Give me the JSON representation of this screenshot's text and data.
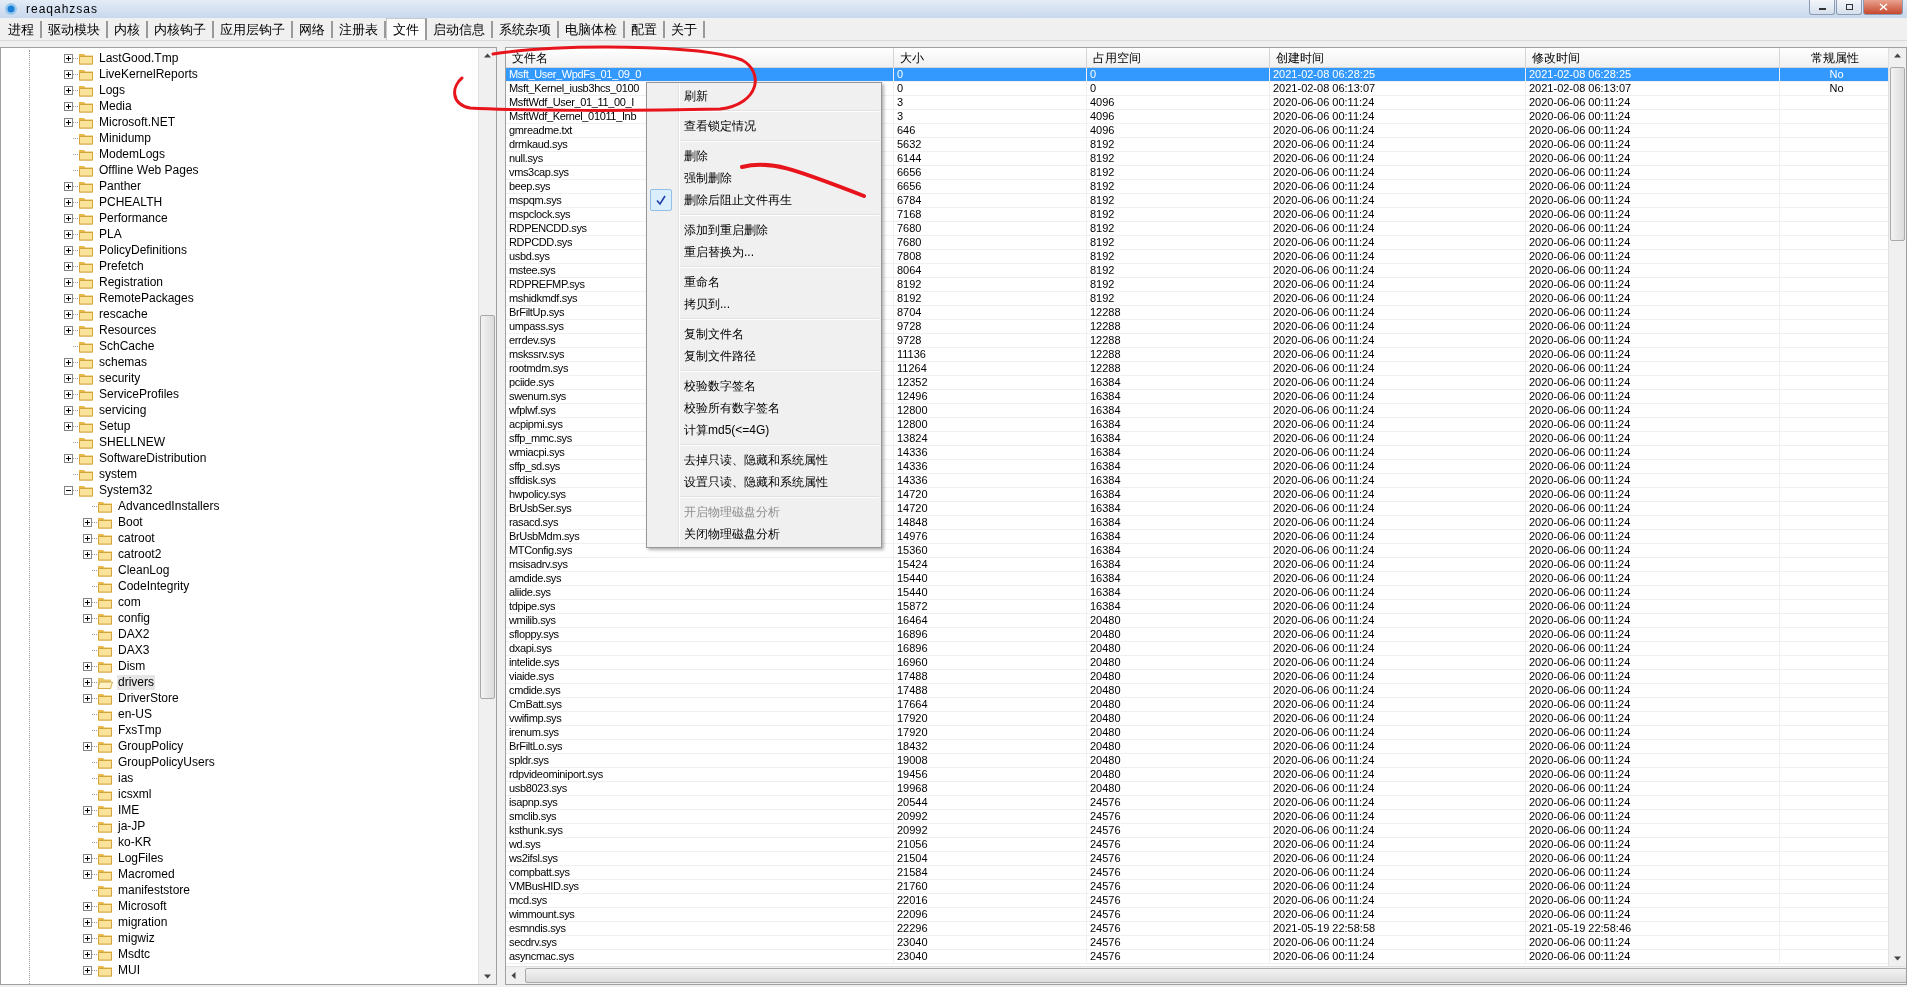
{
  "window": {
    "title": "reaqahzsas"
  },
  "tabs": [
    {
      "label": "进程",
      "selected": false
    },
    {
      "label": "驱动模块",
      "selected": false
    },
    {
      "label": "内核",
      "selected": false
    },
    {
      "label": "内核钩子",
      "selected": false
    },
    {
      "label": "应用层钩子",
      "selected": false
    },
    {
      "label": "网络",
      "selected": false
    },
    {
      "label": "注册表",
      "selected": false
    },
    {
      "label": "文件",
      "selected": true
    },
    {
      "label": "启动信息",
      "selected": false
    },
    {
      "label": "系统杂项",
      "selected": false
    },
    {
      "label": "电脑体检",
      "selected": false
    },
    {
      "label": "配置",
      "selected": false
    },
    {
      "label": "关于",
      "selected": false
    }
  ],
  "tree": [
    {
      "label": "LastGood.Tmp",
      "expandable": true,
      "expanded": false,
      "selected": false
    },
    {
      "label": "LiveKernelReports",
      "expandable": true,
      "expanded": false,
      "selected": false
    },
    {
      "label": "Logs",
      "expandable": true,
      "expanded": false,
      "selected": false
    },
    {
      "label": "Media",
      "expandable": true,
      "expanded": false,
      "selected": false
    },
    {
      "label": "Microsoft.NET",
      "expandable": true,
      "expanded": false,
      "selected": false
    },
    {
      "label": "Minidump",
      "expandable": false,
      "selected": false
    },
    {
      "label": "ModemLogs",
      "expandable": false,
      "selected": false
    },
    {
      "label": "Offline Web Pages",
      "expandable": false,
      "selected": false
    },
    {
      "label": "Panther",
      "expandable": true,
      "expanded": false,
      "selected": false
    },
    {
      "label": "PCHEALTH",
      "expandable": true,
      "expanded": false,
      "selected": false
    },
    {
      "label": "Performance",
      "expandable": true,
      "expanded": false,
      "selected": false
    },
    {
      "label": "PLA",
      "expandable": true,
      "expanded": false,
      "selected": false
    },
    {
      "label": "PolicyDefinitions",
      "expandable": true,
      "expanded": false,
      "selected": false
    },
    {
      "label": "Prefetch",
      "expandable": true,
      "expanded": false,
      "selected": false
    },
    {
      "label": "Registration",
      "expandable": true,
      "expanded": false,
      "selected": false
    },
    {
      "label": "RemotePackages",
      "expandable": true,
      "expanded": false,
      "selected": false
    },
    {
      "label": "rescache",
      "expandable": true,
      "expanded": false,
      "selected": false
    },
    {
      "label": "Resources",
      "expandable": true,
      "expanded": false,
      "selected": false
    },
    {
      "label": "SchCache",
      "expandable": false,
      "selected": false
    },
    {
      "label": "schemas",
      "expandable": true,
      "expanded": false,
      "selected": false
    },
    {
      "label": "security",
      "expandable": true,
      "expanded": false,
      "selected": false
    },
    {
      "label": "ServiceProfiles",
      "expandable": true,
      "expanded": false,
      "selected": false
    },
    {
      "label": "servicing",
      "expandable": true,
      "expanded": false,
      "selected": false
    },
    {
      "label": "Setup",
      "expandable": true,
      "expanded": false,
      "selected": false
    },
    {
      "label": "SHELLNEW",
      "expandable": false,
      "selected": false
    },
    {
      "label": "SoftwareDistribution",
      "expandable": true,
      "expanded": false,
      "selected": false
    },
    {
      "label": "system",
      "expandable": false,
      "selected": false
    },
    {
      "label": "System32",
      "expandable": true,
      "expanded": true,
      "selected": false,
      "children": [
        {
          "label": "AdvancedInstallers",
          "expandable": false,
          "selected": false
        },
        {
          "label": "Boot",
          "expandable": true,
          "expanded": false,
          "selected": false
        },
        {
          "label": "catroot",
          "expandable": true,
          "expanded": false,
          "selected": false
        },
        {
          "label": "catroot2",
          "expandable": true,
          "expanded": false,
          "selected": false
        },
        {
          "label": "CleanLog",
          "expandable": false,
          "selected": false
        },
        {
          "label": "CodeIntegrity",
          "expandable": false,
          "selected": false
        },
        {
          "label": "com",
          "expandable": true,
          "expanded": false,
          "selected": false
        },
        {
          "label": "config",
          "expandable": true,
          "expanded": false,
          "selected": false
        },
        {
          "label": "DAX2",
          "expandable": false,
          "selected": false
        },
        {
          "label": "DAX3",
          "expandable": false,
          "selected": false
        },
        {
          "label": "Dism",
          "expandable": true,
          "expanded": false,
          "selected": false
        },
        {
          "label": "drivers",
          "expandable": true,
          "expanded": false,
          "selected": true
        },
        {
          "label": "DriverStore",
          "expandable": true,
          "expanded": false,
          "selected": false
        },
        {
          "label": "en-US",
          "expandable": false,
          "selected": false
        },
        {
          "label": "FxsTmp",
          "expandable": false,
          "selected": false
        },
        {
          "label": "GroupPolicy",
          "expandable": true,
          "expanded": false,
          "selected": false
        },
        {
          "label": "GroupPolicyUsers",
          "expandable": false,
          "selected": false
        },
        {
          "label": "ias",
          "expandable": false,
          "selected": false
        },
        {
          "label": "icsxml",
          "expandable": false,
          "selected": false
        },
        {
          "label": "IME",
          "expandable": true,
          "expanded": false,
          "selected": false
        },
        {
          "label": "ja-JP",
          "expandable": false,
          "selected": false
        },
        {
          "label": "ko-KR",
          "expandable": false,
          "selected": false
        },
        {
          "label": "LogFiles",
          "expandable": true,
          "expanded": false,
          "selected": false
        },
        {
          "label": "Macromed",
          "expandable": true,
          "expanded": false,
          "selected": false
        },
        {
          "label": "manifeststore",
          "expandable": false,
          "selected": false
        },
        {
          "label": "Microsoft",
          "expandable": true,
          "expanded": false,
          "selected": false
        },
        {
          "label": "migration",
          "expandable": true,
          "expanded": false,
          "selected": false
        },
        {
          "label": "migwiz",
          "expandable": true,
          "expanded": false,
          "selected": false
        },
        {
          "label": "Msdtc",
          "expandable": true,
          "expanded": false,
          "selected": false
        },
        {
          "label": "MUI",
          "expandable": true,
          "expanded": false,
          "selected": false
        }
      ]
    }
  ],
  "table": {
    "circle_mark": true,
    "columns": [
      "文件名",
      "大小",
      "占用空间",
      "创建时间",
      "修改时间",
      "常规属性"
    ],
    "rows": [
      {
        "cells": [
          "Msft_User_WpdFs_01_09_0",
          "0",
          "0",
          "2021-02-08 06:28:25",
          "2021-02-08 06:28:25",
          "No"
        ],
        "selected": true
      },
      {
        "cells": [
          "Msft_Kernel_iusb3hcs_0100",
          "0",
          "0",
          "2021-02-08 06:13:07",
          "2021-02-08 06:13:07",
          "No"
        ],
        "selected": false
      },
      {
        "cells": [
          "MsftWdf_User_01_11_00_I",
          "3",
          "4096",
          "2020-06-06 00:11:24",
          "2020-06-06 00:11:24"
        ],
        "selected": false
      },
      {
        "cells": [
          "MsftWdf_Kernel_01011_Inb",
          "3",
          "4096",
          "2020-06-06 00:11:24",
          "2020-06-06 00:11:24"
        ],
        "selected": false
      },
      {
        "cells": [
          "gmreadme.txt",
          "646",
          "4096",
          "2020-06-06 00:11:24",
          "2020-06-06 00:11:24"
        ],
        "selected": false
      },
      {
        "cells": [
          "drmkaud.sys",
          "5632",
          "8192",
          "2020-06-06 00:11:24",
          "2020-06-06 00:11:24"
        ],
        "selected": false
      },
      {
        "cells": [
          "null.sys",
          "6144",
          "8192",
          "2020-06-06 00:11:24",
          "2020-06-06 00:11:24"
        ],
        "selected": false
      },
      {
        "cells": [
          "vms3cap.sys",
          "6656",
          "8192",
          "2020-06-06 00:11:24",
          "2020-06-06 00:11:24"
        ],
        "selected": false
      },
      {
        "cells": [
          "beep.sys",
          "6656",
          "8192",
          "2020-06-06 00:11:24",
          "2020-06-06 00:11:24"
        ],
        "selected": false
      },
      {
        "cells": [
          "mspqm.sys",
          "6784",
          "8192",
          "2020-06-06 00:11:24",
          "2020-06-06 00:11:24"
        ],
        "selected": false
      },
      {
        "cells": [
          "mspclock.sys",
          "7168",
          "8192",
          "2020-06-06 00:11:24",
          "2020-06-06 00:11:24"
        ],
        "selected": false
      },
      {
        "cells": [
          "RDPENCDD.sys",
          "7680",
          "8192",
          "2020-06-06 00:11:24",
          "2020-06-06 00:11:24"
        ],
        "selected": false
      },
      {
        "cells": [
          "RDPCDD.sys",
          "7680",
          "8192",
          "2020-06-06 00:11:24",
          "2020-06-06 00:11:24"
        ],
        "selected": false
      },
      {
        "cells": [
          "usbd.sys",
          "7808",
          "8192",
          "2020-06-06 00:11:24",
          "2020-06-06 00:11:24"
        ],
        "selected": false
      },
      {
        "cells": [
          "mstee.sys",
          "8064",
          "8192",
          "2020-06-06 00:11:24",
          "2020-06-06 00:11:24"
        ],
        "selected": false
      },
      {
        "cells": [
          "RDPREFMP.sys",
          "8192",
          "8192",
          "2020-06-06 00:11:24",
          "2020-06-06 00:11:24"
        ],
        "selected": false
      },
      {
        "cells": [
          "mshidkmdf.sys",
          "8192",
          "8192",
          "2020-06-06 00:11:24",
          "2020-06-06 00:11:24"
        ],
        "selected": false
      },
      {
        "cells": [
          "BrFiltUp.sys",
          "8704",
          "12288",
          "2020-06-06 00:11:24",
          "2020-06-06 00:11:24"
        ],
        "selected": false
      },
      {
        "cells": [
          "umpass.sys",
          "9728",
          "12288",
          "2020-06-06 00:11:24",
          "2020-06-06 00:11:24"
        ],
        "selected": false
      },
      {
        "cells": [
          "errdev.sys",
          "9728",
          "12288",
          "2020-06-06 00:11:24",
          "2020-06-06 00:11:24"
        ],
        "selected": false
      },
      {
        "cells": [
          "mskssrv.sys",
          "11136",
          "12288",
          "2020-06-06 00:11:24",
          "2020-06-06 00:11:24"
        ],
        "selected": false
      },
      {
        "cells": [
          "rootmdm.sys",
          "11264",
          "12288",
          "2020-06-06 00:11:24",
          "2020-06-06 00:11:24"
        ],
        "selected": false
      },
      {
        "cells": [
          "pciide.sys",
          "12352",
          "16384",
          "2020-06-06 00:11:24",
          "2020-06-06 00:11:24"
        ],
        "selected": false
      },
      {
        "cells": [
          "swenum.sys",
          "12496",
          "16384",
          "2020-06-06 00:11:24",
          "2020-06-06 00:11:24"
        ],
        "selected": false
      },
      {
        "cells": [
          "wfplwf.sys",
          "12800",
          "16384",
          "2020-06-06 00:11:24",
          "2020-06-06 00:11:24"
        ],
        "selected": false
      },
      {
        "cells": [
          "acpipmi.sys",
          "12800",
          "16384",
          "2020-06-06 00:11:24",
          "2020-06-06 00:11:24"
        ],
        "selected": false
      },
      {
        "cells": [
          "sffp_mmc.sys",
          "13824",
          "16384",
          "2020-06-06 00:11:24",
          "2020-06-06 00:11:24"
        ],
        "selected": false
      },
      {
        "cells": [
          "wmiacpi.sys",
          "14336",
          "16384",
          "2020-06-06 00:11:24",
          "2020-06-06 00:11:24"
        ],
        "selected": false
      },
      {
        "cells": [
          "sffp_sd.sys",
          "14336",
          "16384",
          "2020-06-06 00:11:24",
          "2020-06-06 00:11:24"
        ],
        "selected": false
      },
      {
        "cells": [
          "sffdisk.sys",
          "14336",
          "16384",
          "2020-06-06 00:11:24",
          "2020-06-06 00:11:24"
        ],
        "selected": false
      },
      {
        "cells": [
          "hwpolicy.sys",
          "14720",
          "16384",
          "2020-06-06 00:11:24",
          "2020-06-06 00:11:24"
        ],
        "selected": false
      },
      {
        "cells": [
          "BrUsbSer.sys",
          "14720",
          "16384",
          "2020-06-06 00:11:24",
          "2020-06-06 00:11:24"
        ],
        "selected": false
      },
      {
        "cells": [
          "rasacd.sys",
          "14848",
          "16384",
          "2020-06-06 00:11:24",
          "2020-06-06 00:11:24"
        ],
        "selected": false
      },
      {
        "cells": [
          "BrUsbMdm.sys",
          "14976",
          "16384",
          "2020-06-06 00:11:24",
          "2020-06-06 00:11:24"
        ],
        "selected": false
      },
      {
        "cells": [
          "MTConfig.sys",
          "15360",
          "16384",
          "2020-06-06 00:11:24",
          "2020-06-06 00:11:24"
        ],
        "selected": false
      },
      {
        "cells": [
          "msisadrv.sys",
          "15424",
          "16384",
          "2020-06-06 00:11:24",
          "2020-06-06 00:11:24"
        ],
        "selected": false
      },
      {
        "cells": [
          "amdide.sys",
          "15440",
          "16384",
          "2020-06-06 00:11:24",
          "2020-06-06 00:11:24"
        ],
        "selected": false
      },
      {
        "cells": [
          "aliide.sys",
          "15440",
          "16384",
          "2020-06-06 00:11:24",
          "2020-06-06 00:11:24"
        ],
        "selected": false
      },
      {
        "cells": [
          "tdpipe.sys",
          "15872",
          "16384",
          "2020-06-06 00:11:24",
          "2020-06-06 00:11:24"
        ],
        "selected": false
      },
      {
        "cells": [
          "wmilib.sys",
          "16464",
          "20480",
          "2020-06-06 00:11:24",
          "2020-06-06 00:11:24"
        ],
        "selected": false
      },
      {
        "cells": [
          "sfloppy.sys",
          "16896",
          "20480",
          "2020-06-06 00:11:24",
          "2020-06-06 00:11:24"
        ],
        "selected": false
      },
      {
        "cells": [
          "dxapi.sys",
          "16896",
          "20480",
          "2020-06-06 00:11:24",
          "2020-06-06 00:11:24"
        ],
        "selected": false
      },
      {
        "cells": [
          "intelide.sys",
          "16960",
          "20480",
          "2020-06-06 00:11:24",
          "2020-06-06 00:11:24"
        ],
        "selected": false
      },
      {
        "cells": [
          "viaide.sys",
          "17488",
          "20480",
          "2020-06-06 00:11:24",
          "2020-06-06 00:11:24"
        ],
        "selected": false
      },
      {
        "cells": [
          "cmdide.sys",
          "17488",
          "20480",
          "2020-06-06 00:11:24",
          "2020-06-06 00:11:24"
        ],
        "selected": false
      },
      {
        "cells": [
          "CmBatt.sys",
          "17664",
          "20480",
          "2020-06-06 00:11:24",
          "2020-06-06 00:11:24"
        ],
        "selected": false
      },
      {
        "cells": [
          "vwifimp.sys",
          "17920",
          "20480",
          "2020-06-06 00:11:24",
          "2020-06-06 00:11:24"
        ],
        "selected": false
      },
      {
        "cells": [
          "irenum.sys",
          "17920",
          "20480",
          "2020-06-06 00:11:24",
          "2020-06-06 00:11:24"
        ],
        "selected": false
      },
      {
        "cells": [
          "BrFiltLo.sys",
          "18432",
          "20480",
          "2020-06-06 00:11:24",
          "2020-06-06 00:11:24"
        ],
        "selected": false
      },
      {
        "cells": [
          "spldr.sys",
          "19008",
          "20480",
          "2020-06-06 00:11:24",
          "2020-06-06 00:11:24"
        ],
        "selected": false
      },
      {
        "cells": [
          "rdpvideominiport.sys",
          "19456",
          "20480",
          "2020-06-06 00:11:24",
          "2020-06-06 00:11:24"
        ],
        "selected": false
      },
      {
        "cells": [
          "usb8023.sys",
          "19968",
          "20480",
          "2020-06-06 00:11:24",
          "2020-06-06 00:11:24"
        ],
        "selected": false
      },
      {
        "cells": [
          "isapnp.sys",
          "20544",
          "24576",
          "2020-06-06 00:11:24",
          "2020-06-06 00:11:24"
        ],
        "selected": false
      },
      {
        "cells": [
          "smclib.sys",
          "20992",
          "24576",
          "2020-06-06 00:11:24",
          "2020-06-06 00:11:24"
        ],
        "selected": false
      },
      {
        "cells": [
          "ksthunk.sys",
          "20992",
          "24576",
          "2020-06-06 00:11:24",
          "2020-06-06 00:11:24"
        ],
        "selected": false
      },
      {
        "cells": [
          "wd.sys",
          "21056",
          "24576",
          "2020-06-06 00:11:24",
          "2020-06-06 00:11:24"
        ],
        "selected": false
      },
      {
        "cells": [
          "ws2ifsl.sys",
          "21504",
          "24576",
          "2020-06-06 00:11:24",
          "2020-06-06 00:11:24"
        ],
        "selected": false
      },
      {
        "cells": [
          "compbatt.sys",
          "21584",
          "24576",
          "2020-06-06 00:11:24",
          "2020-06-06 00:11:24"
        ],
        "selected": false
      },
      {
        "cells": [
          "VMBusHID.sys",
          "21760",
          "24576",
          "2020-06-06 00:11:24",
          "2020-06-06 00:11:24"
        ],
        "selected": false
      },
      {
        "cells": [
          "mcd.sys",
          "22016",
          "24576",
          "2020-06-06 00:11:24",
          "2020-06-06 00:11:24"
        ],
        "selected": false
      },
      {
        "cells": [
          "wimmount.sys",
          "22096",
          "24576",
          "2020-06-06 00:11:24",
          "2020-06-06 00:11:24"
        ],
        "selected": false
      },
      {
        "cells": [
          "esmndis.sys",
          "22296",
          "24576",
          "2021-05-19 22:58:58",
          "2021-05-19 22:58:46"
        ],
        "selected": false
      },
      {
        "cells": [
          "secdrv.sys",
          "23040",
          "24576",
          "2020-06-06 00:11:24",
          "2020-06-06 00:11:24"
        ],
        "selected": false
      },
      {
        "cells": [
          "asyncmac.sys",
          "23040",
          "24576",
          "2020-06-06 00:11:24",
          "2020-06-06 00:11:24"
        ],
        "selected": false
      }
    ]
  },
  "context_menu": {
    "pen_stroke": true,
    "items": [
      {
        "kind": "item",
        "label": "刷新",
        "checked": false,
        "disabled": false
      },
      {
        "kind": "separator"
      },
      {
        "kind": "item",
        "label": "查看锁定情况",
        "checked": false,
        "disabled": false
      },
      {
        "kind": "separator"
      },
      {
        "kind": "item",
        "label": "删除",
        "checked": false,
        "disabled": false
      },
      {
        "kind": "item",
        "label": "强制删除",
        "checked": false,
        "disabled": false
      },
      {
        "kind": "item",
        "label": "删除后阻止文件再生",
        "checked": true,
        "disabled": false
      },
      {
        "kind": "separator"
      },
      {
        "kind": "item",
        "label": "添加到重启删除",
        "checked": false,
        "disabled": false
      },
      {
        "kind": "item",
        "label": "重启替换为...",
        "checked": false,
        "disabled": false
      },
      {
        "kind": "separator"
      },
      {
        "kind": "item",
        "label": "重命名",
        "checked": false,
        "disabled": false
      },
      {
        "kind": "item",
        "label": "拷贝到...",
        "checked": false,
        "disabled": false
      },
      {
        "kind": "separator"
      },
      {
        "kind": "item",
        "label": "复制文件名",
        "checked": false,
        "disabled": false
      },
      {
        "kind": "item",
        "label": "复制文件路径",
        "checked": false,
        "disabled": false
      },
      {
        "kind": "separator"
      },
      {
        "kind": "item",
        "label": "校验数字签名",
        "checked": false,
        "disabled": false
      },
      {
        "kind": "item",
        "label": "校验所有数字签名",
        "checked": false,
        "disabled": false
      },
      {
        "kind": "item",
        "label": "计算md5(<=4G)",
        "checked": false,
        "disabled": false
      },
      {
        "kind": "separator"
      },
      {
        "kind": "item",
        "label": "去掉只读、隐藏和系统属性",
        "checked": false,
        "disabled": false
      },
      {
        "kind": "item",
        "label": "设置只读、隐藏和系统属性",
        "checked": false,
        "disabled": false
      },
      {
        "kind": "separator"
      },
      {
        "kind": "item",
        "label": "开启物理磁盘分析",
        "checked": false,
        "disabled": true
      },
      {
        "kind": "item",
        "label": "关闭物理磁盘分析",
        "checked": false,
        "disabled": false
      }
    ]
  }
}
